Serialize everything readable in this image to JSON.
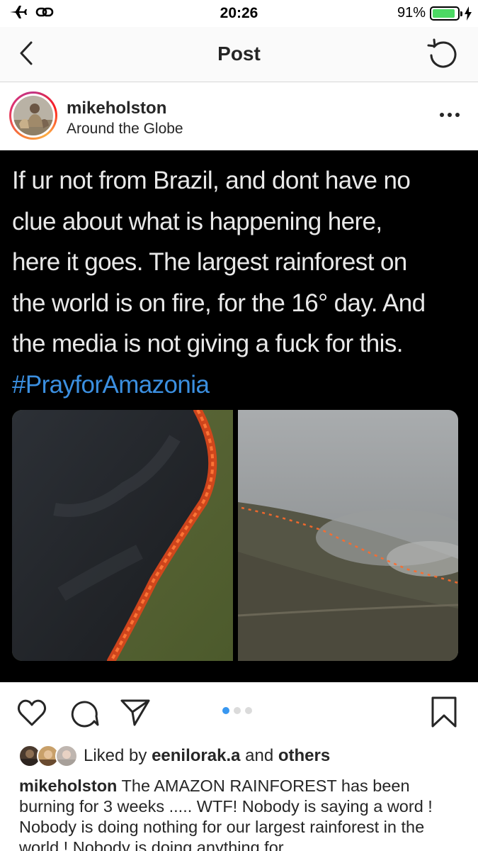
{
  "status_bar": {
    "time": "20:26",
    "battery_percent": "91%",
    "battery_level": 0.91,
    "icons": [
      "airplane-mode-icon",
      "personal-hotspot-icon",
      "battery-icon",
      "charging-bolt-icon"
    ]
  },
  "nav": {
    "title": "Post",
    "back_icon": "chevron-left-icon",
    "refresh_icon": "refresh-icon"
  },
  "post": {
    "username": "mikeholston",
    "location": "Around the Globe",
    "more_icon": "ellipsis-icon",
    "image_text_lines": [
      "If ur not from Brazil, and dont have no",
      "clue about what is happening here,",
      "here it goes. The largest rainforest on",
      "the world is on fire, for the 16° day. And",
      "the media is not giving a fuck for this."
    ],
    "image_hashtag": "#PrayforAmazonia",
    "carousel": {
      "count": 3,
      "active_index": 0
    }
  },
  "actions": {
    "icons": [
      "heart-icon",
      "comment-icon",
      "share-icon",
      "bookmark-icon"
    ]
  },
  "likes": {
    "prefix": "Liked by",
    "user": "eenilorak.a",
    "conjunction": "and",
    "others": "others"
  },
  "caption": {
    "username": "mikeholston",
    "text": "The AMAZON RAINFOREST has been burning for 3 weeks ..... WTF! Nobody is saying a word ! Nobody is doing nothing for our largest rainforest in the world ! Nobody is doing anything for"
  },
  "colors": {
    "battery_green": "#4cd964",
    "hashtag_blue": "#3b8fe0",
    "carousel_active": "#3897f0",
    "text": "#262626"
  }
}
